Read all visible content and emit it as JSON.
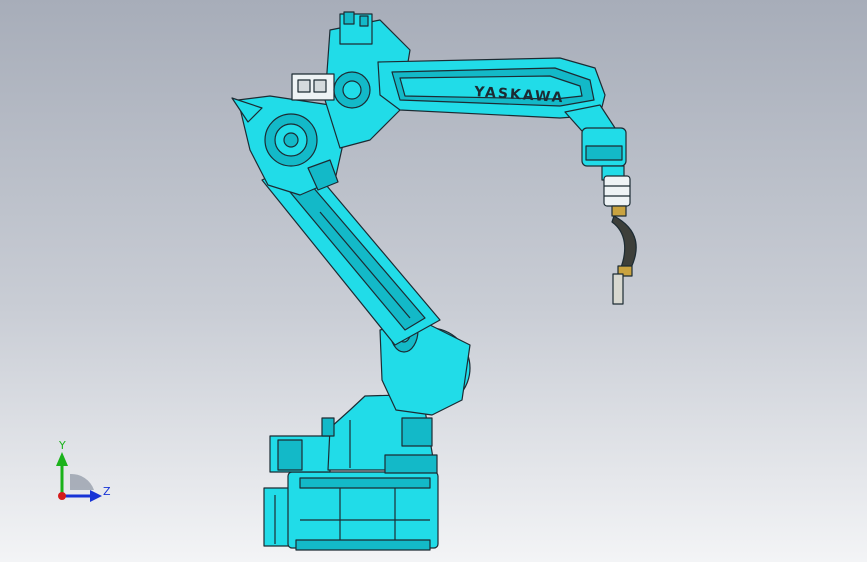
{
  "viewport": {
    "background_top": "#a7adb9",
    "background_bottom": "#f3f4f6"
  },
  "model": {
    "brand_label": "YASKAWA",
    "body_color": "#21dce8",
    "body_shade_color": "#13b9c8",
    "outline_color": "#1c2b33",
    "torch_cable_color": "#3d3f3a",
    "torch_tip_color": "#d8d8d0",
    "torch_nozzle_color": "#c9a340"
  },
  "triad": {
    "y_label": "Y",
    "z_label": "Z",
    "y_color": "#1bb21b",
    "z_color": "#1733d6",
    "x_color": "#d41c1c"
  }
}
